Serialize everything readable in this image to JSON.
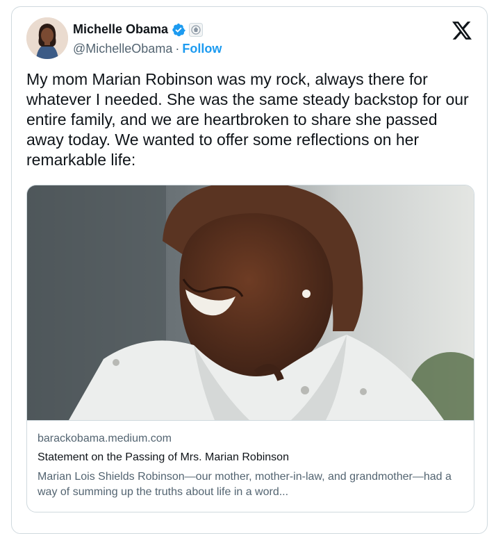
{
  "author": {
    "name": "Michelle Obama",
    "handle": "@MichelleObama",
    "separator": "·",
    "follow_label": "Follow",
    "verified": true,
    "affiliation_badge": "government-seal-icon"
  },
  "platform_logo": "x-logo-icon",
  "tweet": {
    "text": "My mom Marian Robinson was my rock, always there for whatever I needed. She was the same steady backstop for our entire family, and we are heartbroken to share she passed away today. We wanted to offer some reflections on her remarkable life:"
  },
  "link_card": {
    "domain": "barackobama.medium.com",
    "title": "Statement on the Passing of Mrs. Marian Robinson",
    "description": "Marian Lois Shields Robinson—our mother, mother-in-law, and grandmother—had a way of summing up the truths about life in a word..."
  },
  "colors": {
    "accent": "#1d9bf0",
    "text_primary": "#0f1419",
    "text_secondary": "#536471",
    "border": "#cfd9de"
  }
}
